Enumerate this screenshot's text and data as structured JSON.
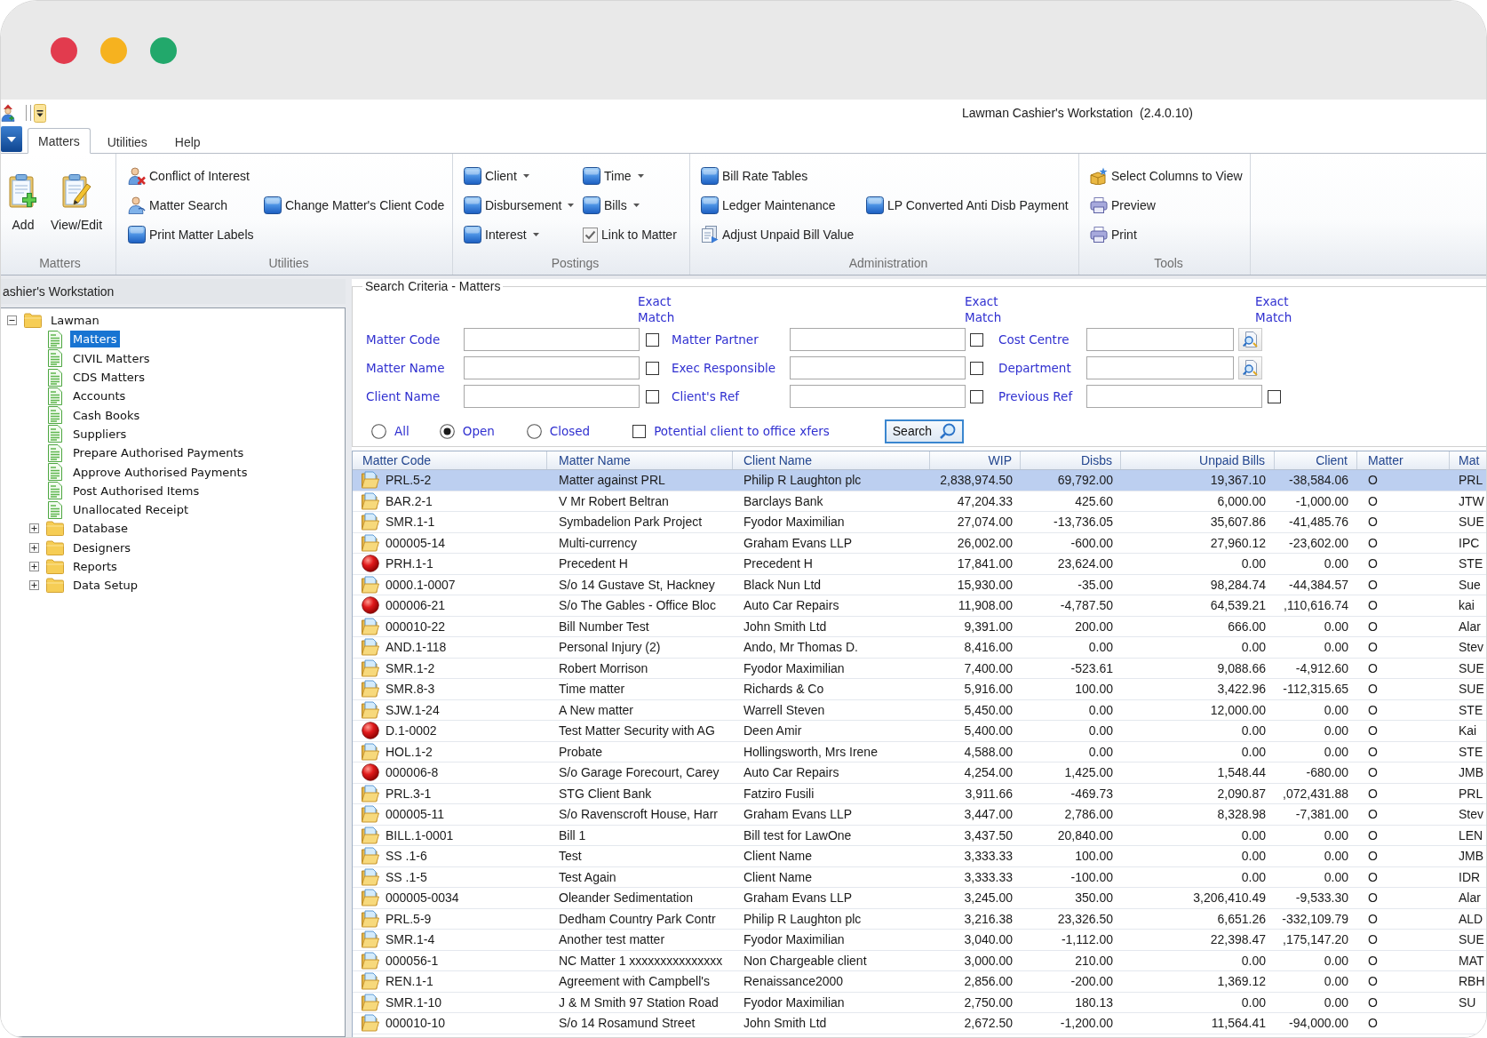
{
  "window": {
    "title": "Lawman Cashier's Workstation  (2.4.0.10)"
  },
  "ribbon_tabs": [
    {
      "label": "Matters",
      "selected": true
    },
    {
      "label": "Utilities",
      "selected": false
    },
    {
      "label": "Help",
      "selected": false
    }
  ],
  "ribbon_groups": [
    {
      "label": "Matters",
      "columns": [
        [
          {
            "label": "Add",
            "kind": "large"
          }
        ],
        [
          {
            "label": "View/Edit",
            "kind": "large"
          }
        ]
      ]
    },
    {
      "label": "Utilities",
      "columns": [
        [
          {
            "label": "Conflict of Interest",
            "kind": "button"
          },
          {
            "label": "Matter Search",
            "kind": "button"
          },
          {
            "label": "Print Matter Labels",
            "kind": "button"
          }
        ],
        [
          {
            "label": "Change Matter's Client Code",
            "kind": "button"
          }
        ]
      ]
    },
    {
      "label": "Postings",
      "columns": [
        [
          {
            "label": "Client",
            "kind": "dropdown"
          },
          {
            "label": "Disbursement",
            "kind": "dropdown"
          },
          {
            "label": "Interest",
            "kind": "dropdown"
          }
        ],
        [
          {
            "label": "Time",
            "kind": "dropdown"
          },
          {
            "label": "Bills",
            "kind": "dropdown"
          },
          {
            "label": "Link to Matter",
            "kind": "checkbox",
            "checked": true
          }
        ]
      ]
    },
    {
      "label": "Administration",
      "columns": [
        [
          {
            "label": "Bill Rate Tables",
            "kind": "button"
          },
          {
            "label": "Ledger Maintenance",
            "kind": "button"
          },
          {
            "label": "Adjust Unpaid Bill Value",
            "kind": "button"
          }
        ],
        [
          {
            "label": "LP Converted Anti Disb Payment",
            "kind": "button"
          }
        ]
      ]
    },
    {
      "label": "Tools",
      "columns": [
        [
          {
            "label": "Select Columns to View",
            "kind": "button"
          },
          {
            "label": "Preview",
            "kind": "button"
          },
          {
            "label": "Print",
            "kind": "button"
          }
        ]
      ]
    }
  ],
  "navigator": {
    "title": "ashier's Workstation",
    "tree": [
      {
        "label": "Lawman",
        "kind": "folder",
        "expanded": true,
        "selected": false,
        "children": [
          {
            "label": "Matters",
            "kind": "page",
            "selected": true
          },
          {
            "label": "CIVIL Matters",
            "kind": "page",
            "selected": false
          },
          {
            "label": "CDS Matters",
            "kind": "page",
            "selected": false
          },
          {
            "label": "Accounts",
            "kind": "page",
            "selected": false
          },
          {
            "label": "Cash Books",
            "kind": "page",
            "selected": false
          },
          {
            "label": "Suppliers",
            "kind": "page",
            "selected": false
          },
          {
            "label": "Prepare Authorised Payments",
            "kind": "page",
            "selected": false
          },
          {
            "label": "Approve Authorised Payments",
            "kind": "page",
            "selected": false
          },
          {
            "label": "Post Authorised Items",
            "kind": "page",
            "selected": false
          },
          {
            "label": "Unallocated Receipt",
            "kind": "page",
            "selected": false
          },
          {
            "label": "Database",
            "kind": "folder",
            "expanded": false,
            "selected": false
          },
          {
            "label": "Designers",
            "kind": "folder",
            "expanded": false,
            "selected": false
          },
          {
            "label": "Reports",
            "kind": "folder",
            "expanded": false,
            "selected": false
          },
          {
            "label": "Data Setup",
            "kind": "folder",
            "expanded": false,
            "selected": false
          }
        ]
      }
    ]
  },
  "search_criteria": {
    "title": "Search Criteria - Matters",
    "columns": [
      {
        "exact_match_label": "Exact Match",
        "fields": [
          {
            "label": "Matter Code",
            "kind": "text",
            "exact_match": false
          },
          {
            "label": "Matter Name",
            "kind": "text",
            "exact_match": false
          },
          {
            "label": "Client Name",
            "kind": "text",
            "exact_match": false
          }
        ]
      },
      {
        "exact_match_label": "Exact Match",
        "fields": [
          {
            "label": "Matter Partner",
            "kind": "text",
            "exact_match": false
          },
          {
            "label": "Exec Responsible",
            "kind": "text",
            "exact_match": false
          },
          {
            "label": "Client's Ref",
            "kind": "text",
            "exact_match": false
          }
        ]
      },
      {
        "exact_match_label": "Exact Match",
        "fields": [
          {
            "label": "Cost Centre",
            "kind": "lookup"
          },
          {
            "label": "Department",
            "kind": "lookup"
          },
          {
            "label": "Previous Ref",
            "kind": "text",
            "exact_match": false
          }
        ]
      }
    ],
    "status_options": [
      {
        "label": "All",
        "selected": false
      },
      {
        "label": "Open",
        "selected": true
      },
      {
        "label": "Closed",
        "selected": false
      }
    ],
    "potential_client_xfers": {
      "label": "Potential client to office xfers",
      "checked": false
    },
    "search_button": "Search"
  },
  "matters_table": {
    "columns": [
      "Matter Code",
      "Matter Name",
      "Client Name",
      "WIP",
      "Disbs",
      "Unpaid Bills",
      "Client",
      "Matter",
      "Mat"
    ],
    "rows": [
      {
        "flagged": false,
        "selected": true,
        "cells": [
          "PRL.5-2",
          "Matter against PRL",
          "Philip R Laughton plc",
          "2,838,974.50",
          "69,792.00",
          "19,367.10",
          "-38,584.06",
          "O",
          "PRL"
        ]
      },
      {
        "flagged": false,
        "selected": false,
        "cells": [
          "BAR.2-1",
          "V Mr Robert Beltran",
          "Barclays Bank",
          "47,204.33",
          "425.60",
          "6,000.00",
          "-1,000.00",
          "O",
          "JTW"
        ]
      },
      {
        "flagged": false,
        "selected": false,
        "cells": [
          "SMR.1-1",
          "Symbadelion Park Project",
          "Fyodor Maximilian",
          "27,074.00",
          "-13,736.05",
          "35,607.86",
          "-41,485.76",
          "O",
          "SUE"
        ]
      },
      {
        "flagged": false,
        "selected": false,
        "cells": [
          "000005-14",
          "Multi-currency",
          "Graham Evans LLP",
          "26,002.00",
          "-600.00",
          "27,960.12",
          "-23,602.00",
          "O",
          "IPC"
        ]
      },
      {
        "flagged": true,
        "selected": false,
        "cells": [
          "PRH.1-1",
          "Precedent H",
          "Precedent H",
          "17,841.00",
          "23,624.00",
          "0.00",
          "0.00",
          "O",
          "STE"
        ]
      },
      {
        "flagged": false,
        "selected": false,
        "cells": [
          "0000.1-0007",
          "S/o 14 Gustave St, Hackney",
          "Black Nun Ltd",
          "15,930.00",
          "-35.00",
          "98,284.74",
          "-44,384.57",
          "O",
          "Sue"
        ]
      },
      {
        "flagged": true,
        "selected": false,
        "cells": [
          "000006-21",
          "S/o The Gables - Office Bloc",
          "Auto Car Repairs",
          "11,908.00",
          "-4,787.50",
          "64,539.21",
          ",110,616.74",
          "O",
          "kai"
        ]
      },
      {
        "flagged": false,
        "selected": false,
        "cells": [
          "000010-22",
          "Bill Number Test",
          "John Smith Ltd",
          "9,391.00",
          "200.00",
          "666.00",
          "0.00",
          "O",
          "Alar"
        ]
      },
      {
        "flagged": false,
        "selected": false,
        "cells": [
          "AND.1-118",
          "Personal Injury (2)",
          "Ando, Mr Thomas D.",
          "8,416.00",
          "0.00",
          "0.00",
          "0.00",
          "O",
          "Stev"
        ]
      },
      {
        "flagged": false,
        "selected": false,
        "cells": [
          "SMR.1-2",
          "Robert Morrison",
          "Fyodor Maximilian",
          "7,400.00",
          "-523.61",
          "9,088.66",
          "-4,912.60",
          "O",
          "SUE"
        ]
      },
      {
        "flagged": false,
        "selected": false,
        "cells": [
          "SMR.8-3",
          "Time matter",
          "Richards & Co",
          "5,916.00",
          "100.00",
          "3,422.96",
          "-112,315.65",
          "O",
          "SUE"
        ]
      },
      {
        "flagged": false,
        "selected": false,
        "cells": [
          "SJW.1-24",
          "A New matter",
          "Warrell Steven",
          "5,450.00",
          "0.00",
          "12,000.00",
          "0.00",
          "O",
          "STE"
        ]
      },
      {
        "flagged": true,
        "selected": false,
        "cells": [
          "D.1-0002",
          "Test Matter Security with AG",
          "Deen Amir",
          "5,400.00",
          "0.00",
          "0.00",
          "0.00",
          "O",
          "Kai"
        ]
      },
      {
        "flagged": false,
        "selected": false,
        "cells": [
          "HOL.1-2",
          "Probate",
          "Hollingsworth, Mrs Irene",
          "4,588.00",
          "0.00",
          "0.00",
          "0.00",
          "O",
          "STE"
        ]
      },
      {
        "flagged": true,
        "selected": false,
        "cells": [
          "000006-8",
          "S/o Garage Forecourt, Carey",
          "Auto Car Repairs",
          "4,254.00",
          "1,425.00",
          "1,548.44",
          "-680.00",
          "O",
          "JMB"
        ]
      },
      {
        "flagged": false,
        "selected": false,
        "cells": [
          "PRL.3-1",
          "STG Client Bank",
          "Fatziro Fusili",
          "3,911.66",
          "-469.73",
          "2,090.87",
          ",072,431.88",
          "O",
          "PRL"
        ]
      },
      {
        "flagged": false,
        "selected": false,
        "cells": [
          "000005-11",
          "S/o Ravenscroft House, Harr",
          "Graham Evans LLP",
          "3,447.00",
          "2,786.00",
          "8,328.98",
          "-7,381.00",
          "O",
          "Stev"
        ]
      },
      {
        "flagged": false,
        "selected": false,
        "cells": [
          "BILL.1-0001",
          "Bill 1",
          "Bill test for LawOne",
          "3,437.50",
          "20,840.00",
          "0.00",
          "0.00",
          "O",
          "LEN"
        ]
      },
      {
        "flagged": false,
        "selected": false,
        "cells": [
          "SS .1-6",
          "Test",
          "Client Name",
          "3,333.33",
          "100.00",
          "0.00",
          "0.00",
          "O",
          "JMB"
        ]
      },
      {
        "flagged": false,
        "selected": false,
        "cells": [
          "SS .1-5",
          "Test Again",
          "Client Name",
          "3,333.33",
          "-100.00",
          "0.00",
          "0.00",
          "O",
          "IDR"
        ]
      },
      {
        "flagged": false,
        "selected": false,
        "cells": [
          "000005-0034",
          "Oleander Sedimentation",
          "Graham Evans LLP",
          "3,245.00",
          "350.00",
          "3,206,410.49",
          "-9,533.30",
          "O",
          "Alar"
        ]
      },
      {
        "flagged": false,
        "selected": false,
        "cells": [
          "PRL.5-9",
          "Dedham Country Park Contr",
          "Philip R Laughton plc",
          "3,216.38",
          "23,326.50",
          "6,651.26",
          "-332,109.79",
          "O",
          "ALD"
        ]
      },
      {
        "flagged": false,
        "selected": false,
        "cells": [
          "SMR.1-4",
          "Another test matter",
          "Fyodor Maximilian",
          "3,040.00",
          "-1,112.00",
          "22,398.47",
          ",175,147.20",
          "O",
          "SUE"
        ]
      },
      {
        "flagged": false,
        "selected": false,
        "cells": [
          "000056-1",
          "NC Matter 1 xxxxxxxxxxxxxxx",
          "Non Chargeable client",
          "3,000.00",
          "210.00",
          "0.00",
          "0.00",
          "O",
          "MAT"
        ]
      },
      {
        "flagged": false,
        "selected": false,
        "cells": [
          "REN.1-1",
          "Agreement with Campbell's",
          "Renaissance2000",
          "2,856.00",
          "-200.00",
          "1,369.12",
          "0.00",
          "O",
          "RBH"
        ]
      },
      {
        "flagged": false,
        "selected": false,
        "cells": [
          "SMR.1-10",
          "J & M Smith 97 Station Road",
          "Fyodor Maximilian",
          "2,750.00",
          "180.13",
          "0.00",
          "0.00",
          "O",
          "SU"
        ]
      },
      {
        "flagged": false,
        "selected": false,
        "cells": [
          "000010-10",
          "S/o 14 Rosamund Street",
          "John Smith Ltd",
          "2,672.50",
          "-1,200.00",
          "11,564.41",
          "-94,000.00",
          "O"
        ]
      }
    ]
  }
}
